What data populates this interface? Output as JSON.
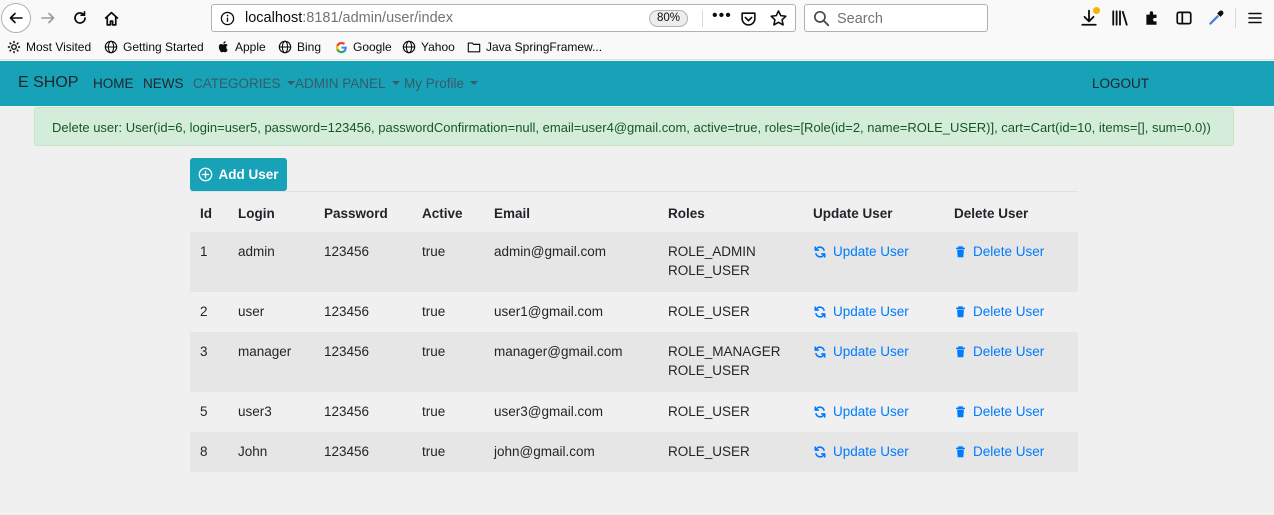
{
  "browser": {
    "url_host": "localhost",
    "url_rest": ":8181/admin/user/index",
    "zoom": "80%",
    "more_label": "•••",
    "search_placeholder": "Search"
  },
  "bookmarks": [
    {
      "label": "Most Visited",
      "icon": "gear-icon"
    },
    {
      "label": "Getting Started",
      "icon": "globe-icon"
    },
    {
      "label": "Apple",
      "icon": "apple-icon"
    },
    {
      "label": "Bing",
      "icon": "globe-icon"
    },
    {
      "label": "Google",
      "icon": "google-icon"
    },
    {
      "label": "Yahoo",
      "icon": "globe-icon"
    },
    {
      "label": "Java SpringFramew...",
      "icon": "folder-icon"
    }
  ],
  "navbar": {
    "brand": "E SHOP",
    "home": "HOME",
    "news": "NEWS",
    "categories": "CATEGORIES",
    "admin_panel": "ADMIN PANEL",
    "my_profile": "My Profile",
    "logout": "LOGOUT",
    "color": "#17a2b8"
  },
  "alert": {
    "message": "Delete user: User(id=6, login=user5, password=123456, passwordConfirmation=null, email=user4@gmail.com, active=true, roles=[Role(id=2, name=ROLE_USER)], cart=Cart(id=10, items=[], sum=0.0))"
  },
  "add_user_label": "Add User",
  "table": {
    "headers": {
      "id": "Id",
      "login": "Login",
      "password": "Password",
      "active": "Active",
      "email": "Email",
      "roles": "Roles",
      "update": "Update User",
      "delete": "Delete User"
    },
    "update_label": "Update User",
    "delete_label": "Delete User",
    "rows": [
      {
        "id": "1",
        "login": "admin",
        "password": "123456",
        "active": "true",
        "email": "admin@gmail.com",
        "roles": [
          "ROLE_ADMIN",
          "ROLE_USER"
        ]
      },
      {
        "id": "2",
        "login": "user",
        "password": "123456",
        "active": "true",
        "email": "user1@gmail.com",
        "roles": [
          "ROLE_USER"
        ]
      },
      {
        "id": "3",
        "login": "manager",
        "password": "123456",
        "active": "true",
        "email": "manager@gmail.com",
        "roles": [
          "ROLE_MANAGER",
          "ROLE_USER"
        ]
      },
      {
        "id": "5",
        "login": "user3",
        "password": "123456",
        "active": "true",
        "email": "user3@gmail.com",
        "roles": [
          "ROLE_USER"
        ]
      },
      {
        "id": "8",
        "login": "John",
        "password": "123456",
        "active": "true",
        "email": "john@gmail.com",
        "roles": [
          "ROLE_USER"
        ]
      }
    ]
  }
}
